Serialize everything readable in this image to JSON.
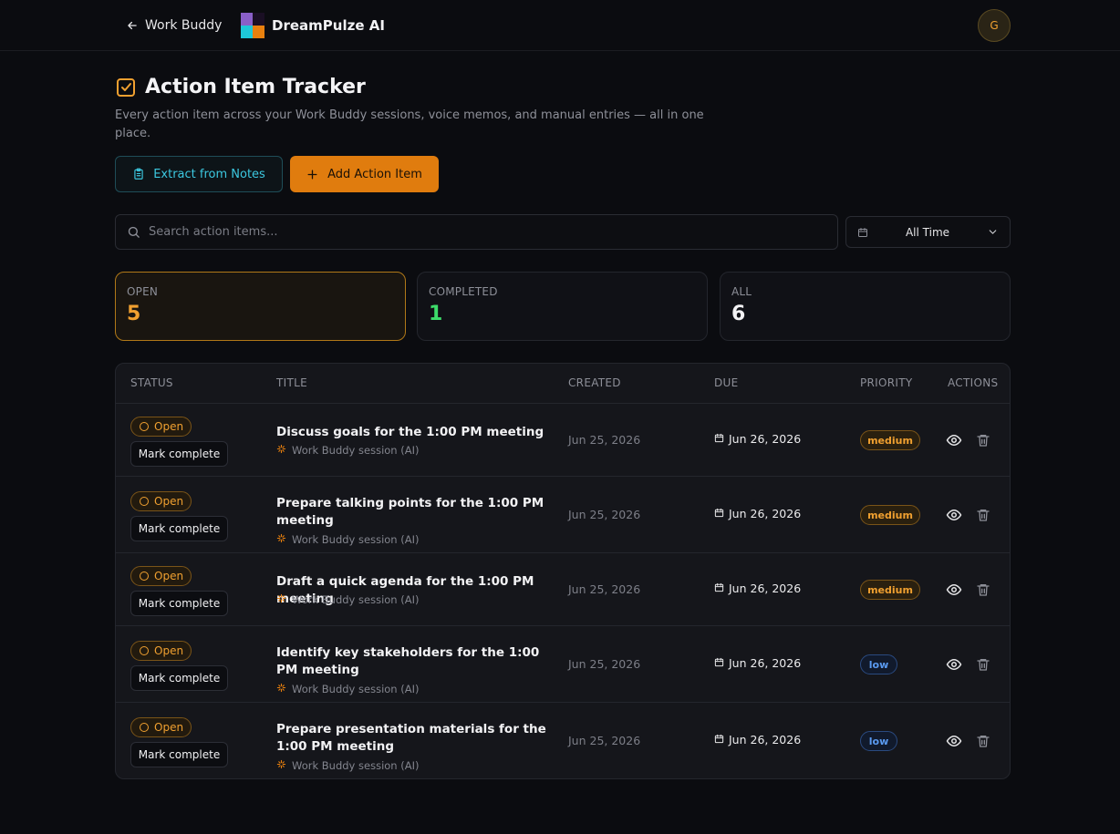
{
  "header": {
    "back_label": "Work Buddy",
    "brand_name": "DreamPulze AI",
    "avatar_initial": "G"
  },
  "page": {
    "title": "Action Item Tracker",
    "subtitle": "Every action item across your Work Buddy sessions, voice memos, and manual entries — all in one place.",
    "extract_button": "Extract from Notes",
    "add_button": "Add Action Item",
    "search_placeholder": "Search action items...",
    "time_filter": "All Time"
  },
  "stats": [
    {
      "label": "OPEN",
      "value": "5",
      "color": "#f0a030"
    },
    {
      "label": "COMPLETED",
      "value": "1",
      "color": "#3ddc6a"
    },
    {
      "label": "ALL",
      "value": "6",
      "color": "#f2f2f4"
    }
  ],
  "table": {
    "columns": [
      "STATUS",
      "TITLE",
      "CREATED",
      "DUE",
      "PRIORITY",
      "ACTIONS"
    ],
    "rows": [
      {
        "status": "Open",
        "mark": "Mark complete",
        "title": "Discuss goals for the 1:00 PM meeting",
        "source": "Work Buddy session (AI)",
        "created": "Jun 25, 2026",
        "due": "Jun 26, 2026",
        "priority": "medium"
      },
      {
        "status": "Open",
        "mark": "Mark complete",
        "title": "Prepare talking points for the 1:00 PM meeting",
        "source": "Work Buddy session (AI)",
        "created": "Jun 25, 2026",
        "due": "Jun 26, 2026",
        "priority": "medium"
      },
      {
        "status": "Open",
        "mark": "Mark complete",
        "title": "Draft a quick agenda for the 1:00 PM meeting",
        "source": "Work Buddy session (AI)",
        "created": "Jun 25, 2026",
        "due": "Jun 26, 2026",
        "priority": "medium"
      },
      {
        "status": "Open",
        "mark": "Mark complete",
        "title": "Identify key stakeholders for the 1:00 PM meeting",
        "source": "Work Buddy session (AI)",
        "created": "Jun 25, 2026",
        "due": "Jun 26, 2026",
        "priority": "low"
      },
      {
        "status": "Open",
        "mark": "Mark complete",
        "title": "Prepare presentation materials for the 1:00 PM meeting",
        "source": "Work Buddy session (AI)",
        "created": "Jun 25, 2026",
        "due": "Jun 26, 2026",
        "priority": "low"
      }
    ]
  },
  "colors": {
    "accent": "#e07c0e",
    "cyan": "#3cc8e0",
    "low_priority": "#5a9af0"
  }
}
